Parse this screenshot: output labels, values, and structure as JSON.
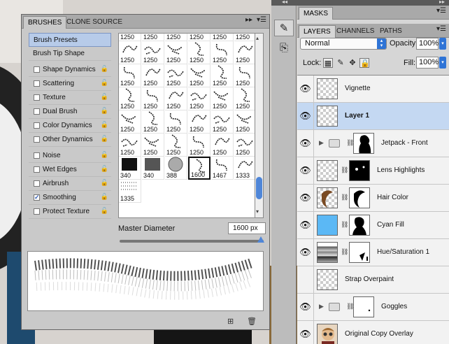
{
  "brushes_panel": {
    "tabs": [
      {
        "label": "BRUSHES"
      },
      {
        "label": "CLONE SOURCE"
      }
    ],
    "options": [
      {
        "label": "Brush Presets",
        "type": "header",
        "selected": true
      },
      {
        "label": "Brush Tip Shape",
        "type": "header",
        "selected": false
      },
      {
        "label": "Shape Dynamics",
        "checked": false
      },
      {
        "label": "Scattering",
        "checked": false
      },
      {
        "label": "Texture",
        "checked": false
      },
      {
        "label": "Dual Brush",
        "checked": false
      },
      {
        "label": "Color Dynamics",
        "checked": false
      },
      {
        "label": "Other Dynamics",
        "checked": false
      },
      {
        "label": "Noise",
        "checked": false
      },
      {
        "label": "Wet Edges",
        "checked": false
      },
      {
        "label": "Airbrush",
        "checked": false
      },
      {
        "label": "Smoothing",
        "checked": true
      },
      {
        "label": "Protect Texture",
        "checked": false
      }
    ],
    "top_row_labels": [
      "1250",
      "1250",
      "1250",
      "1250",
      "1250",
      "1250"
    ],
    "brush_rows": [
      [
        "1250",
        "1250",
        "1250",
        "1250",
        "1250",
        "1250"
      ],
      [
        "1250",
        "1250",
        "1250",
        "1250",
        "1250",
        "1250"
      ],
      [
        "1250",
        "1250",
        "1250",
        "1250",
        "1250",
        "1250"
      ],
      [
        "1250",
        "1250",
        "1250",
        "1250",
        "1250",
        "1250"
      ],
      [
        "1250",
        "1250",
        "1250",
        "1250",
        "1250",
        "1250"
      ],
      [
        "340",
        "340",
        "388",
        "1600",
        "1467",
        "1333"
      ],
      [
        "1335"
      ]
    ],
    "selected_brush": "1600",
    "master_diameter_label": "Master Diameter",
    "master_diameter_value": "1600 px",
    "master_diameter_fraction": 0.98
  },
  "masks_tab": {
    "label": "MASKS"
  },
  "layers_panel": {
    "tabs": [
      {
        "label": "LAYERS"
      },
      {
        "label": "CHANNELS"
      },
      {
        "label": "PATHS"
      }
    ],
    "blend_mode": "Normal",
    "opacity_label": "Opacity:",
    "opacity_value": "100%",
    "lock_label": "Lock:",
    "fill_label": "Fill:",
    "fill_value": "100%",
    "layers": [
      {
        "name": "Vignette",
        "kind": "pixel"
      },
      {
        "name": "Layer 1",
        "kind": "pixel",
        "selected": true
      },
      {
        "name": "Jetpack - Front",
        "kind": "group"
      },
      {
        "name": "Lens Highlights",
        "kind": "masked"
      },
      {
        "name": "Hair Color",
        "kind": "masked"
      },
      {
        "name": "Cyan Fill",
        "kind": "masked"
      },
      {
        "name": "Hue/Saturation 1",
        "kind": "adjustment"
      },
      {
        "name": "Strap Overpaint",
        "kind": "pixel"
      },
      {
        "name": "Goggles",
        "kind": "group"
      },
      {
        "name": "Original Copy Overlay",
        "kind": "photo"
      }
    ]
  },
  "colors": {
    "accent": "#2f74d6",
    "selection": "#c4d8f2",
    "cyan_fill": "#5bb8f5"
  }
}
